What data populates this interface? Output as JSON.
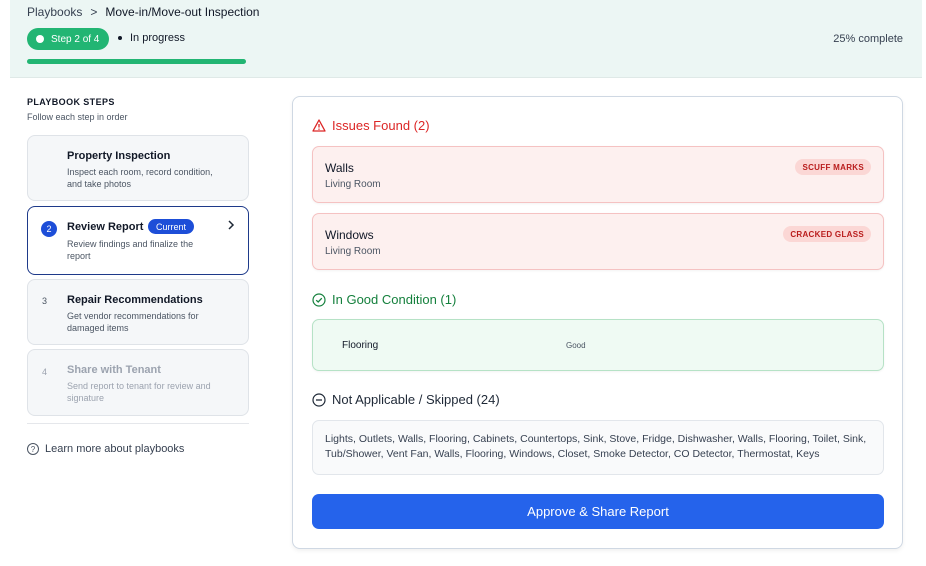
{
  "breadcrumb": {
    "root": "Playbooks",
    "separator": ">",
    "current": "Move-in/Move-out Inspection"
  },
  "progress": {
    "step_label": "Step 2 of 4",
    "status": "In progress",
    "percent_label": "25% complete",
    "percent": 25
  },
  "sidebar": {
    "title": "PLAYBOOK STEPS",
    "subtitle": "Follow each step in order",
    "steps": [
      {
        "number": "",
        "title": "Property Inspection",
        "desc": "Inspect each room, record condition, and take photos"
      },
      {
        "number": "2",
        "title": "Review Report",
        "badge": "Current",
        "desc": "Review findings and finalize the report"
      },
      {
        "number": "3",
        "title": "Repair Recommendations",
        "desc": "Get vendor recommendations for damaged items"
      },
      {
        "number": "4",
        "title": "Share with Tenant",
        "desc": "Send report to tenant for review and signature"
      }
    ],
    "learn_more": "Learn more about playbooks"
  },
  "report": {
    "issues_heading": "Issues Found (2)",
    "issues": [
      {
        "name": "Walls",
        "room": "Living Room",
        "tag": "SCUFF MARKS"
      },
      {
        "name": "Windows",
        "room": "Living Room",
        "tag": "CRACKED GLASS"
      }
    ],
    "good_heading": "In Good Condition (1)",
    "good": [
      {
        "name": "Flooring",
        "value": "Good"
      }
    ],
    "na_heading": "Not Applicable / Skipped (24)",
    "na_list": "Lights, Outlets, Walls, Flooring, Cabinets, Countertops, Sink, Stove, Fridge, Dishwasher, Walls, Flooring, Toilet, Sink, Tub/Shower, Vent Fan, Walls, Flooring, Windows, Closet, Smoke Detector, CO Detector, Thermostat, Keys",
    "approve_label": "Approve & Share Report"
  },
  "colors": {
    "accent_green": "#22b573",
    "primary_blue": "#2563eb",
    "danger_red": "#dc2626",
    "success_green": "#15803d"
  },
  "icons": {
    "issues": "warning-triangle-icon",
    "good": "check-circle-icon",
    "na": "minus-circle-icon",
    "help": "question-circle-icon",
    "chevron": "chevron-right-icon"
  }
}
